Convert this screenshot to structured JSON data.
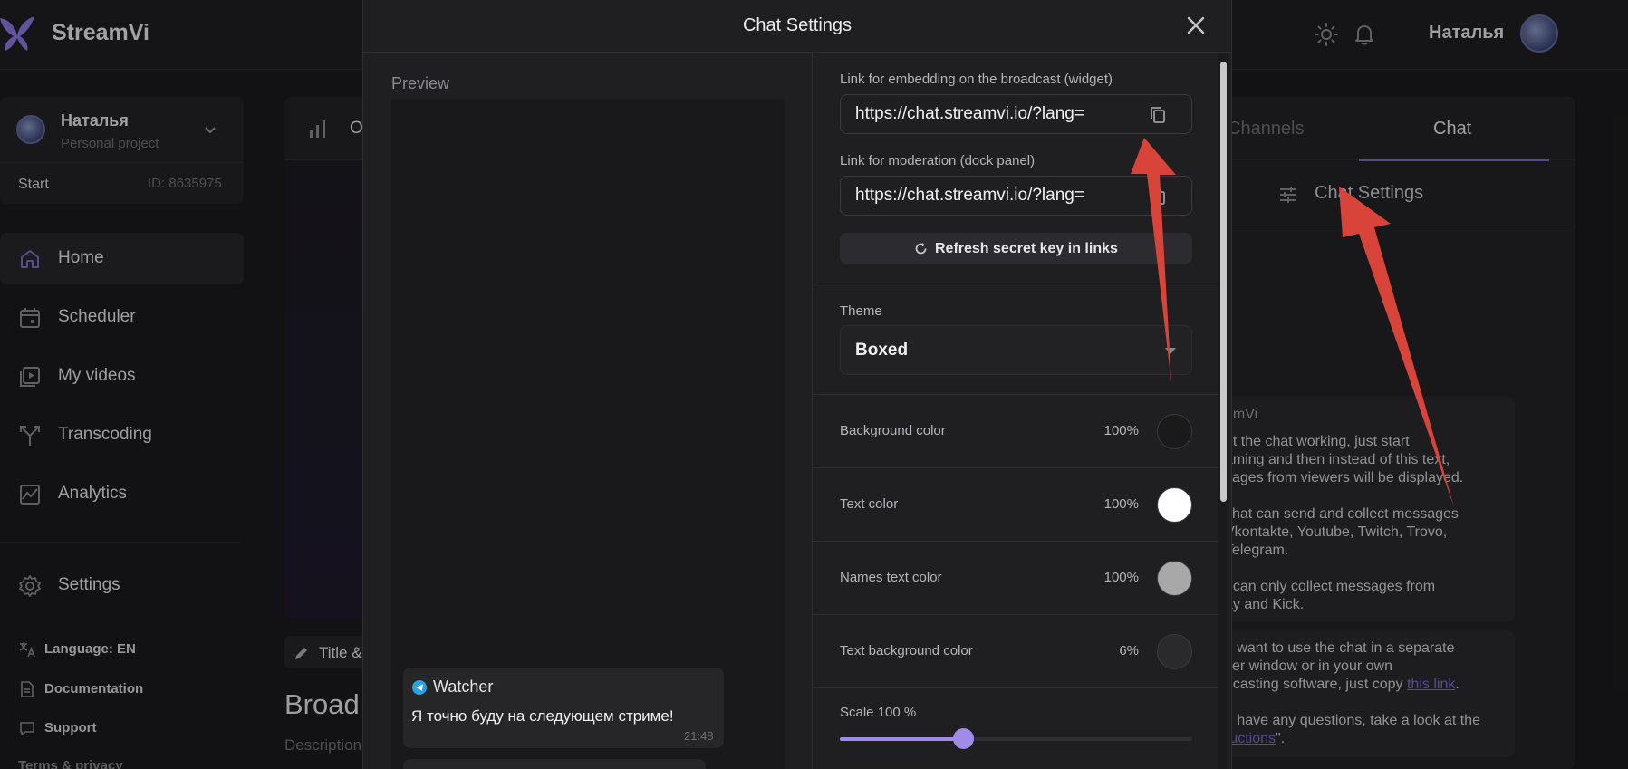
{
  "app": {
    "brand_name": "StreamVi",
    "accent_color": "#7b6bd0",
    "user_name": "Наталья"
  },
  "project": {
    "name": "Наталья",
    "subtitle": "Personal project",
    "plan": "Start",
    "id_label": "ID: 8635975"
  },
  "sidebar": {
    "items": [
      {
        "label": "Home",
        "icon": "home-icon"
      },
      {
        "label": "Scheduler",
        "icon": "calendar-icon"
      },
      {
        "label": "My videos",
        "icon": "video-icon"
      },
      {
        "label": "Transcoding",
        "icon": "transcoding-icon"
      },
      {
        "label": "Analytics",
        "icon": "analytics-icon"
      },
      {
        "label": "Settings",
        "icon": "gear-icon"
      }
    ],
    "links": [
      {
        "label": "Language: EN",
        "icon": "translate-icon"
      },
      {
        "label": "Documentation",
        "icon": "document-icon"
      },
      {
        "label": "Support",
        "icon": "support-icon"
      },
      {
        "label": "Terms & privacy",
        "icon": ""
      }
    ]
  },
  "background": {
    "card_title_fragment": "O",
    "title_pill": "Title &",
    "broadcast_heading": "Broad",
    "description_label": "Description"
  },
  "right_panel": {
    "tab_channels": "Channels",
    "tab_chat": "Chat",
    "chat_settings_button": "Chat Settings",
    "box1_lines": [
      "amVi",
      "et the chat working, just start",
      "aming and then instead of this text,",
      "sages from viewers will be displayed.",
      "",
      "chat can send and collect messages",
      "Vkontakte, Youtube, Twitch, Trovo,",
      "Telegram.",
      "",
      "t can only collect messages from",
      "ay and Kick."
    ],
    "box2_line1": "u want to use the chat in a separate",
    "box2_line2": "ser window or in your own",
    "box2_line3_prefix": "dcasting software, just copy ",
    "box2_link": "this link",
    "box2_line3_suffix": ".",
    "box2_line4": "u have any questions, take a look at the",
    "box2_link2": "ructions",
    "box2_line5_suffix": "\"."
  },
  "modal": {
    "title": "Chat Settings",
    "preview_label": "Preview",
    "message": {
      "author": "Watcher",
      "text": "Я точно буду на следующем стриме!",
      "time": "21:48"
    },
    "widget_link_label": "Link for embedding on the broadcast (widget)",
    "widget_link_value": "https://chat.streamvi.io/?lang=",
    "moderation_link_label": "Link for moderation (dock panel)",
    "moderation_link_value": "https://chat.streamvi.io/?lang=",
    "refresh_button": "Refresh secret key in links",
    "theme_label": "Theme",
    "theme_value": "Boxed",
    "colors": [
      {
        "label": "Background color",
        "percent": "100%",
        "color": "#1a1a1a"
      },
      {
        "label": "Text color",
        "percent": "100%",
        "color": "#ffffff"
      },
      {
        "label": "Names text color",
        "percent": "100%",
        "color": "#a8a8a8"
      },
      {
        "label": "Text background color",
        "percent": "6%",
        "color": "#2a2a2d"
      }
    ],
    "scale_label": "Scale 100 %",
    "scale_fraction": 0.35
  }
}
